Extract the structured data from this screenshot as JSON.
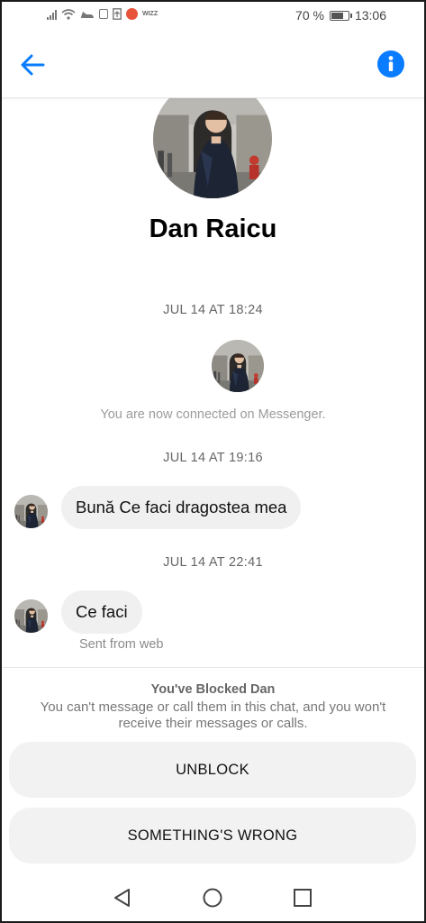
{
  "status_bar": {
    "battery_text": "70 %",
    "time": "13:06",
    "wiz_label": "WIZZ"
  },
  "header": {
    "back_icon": "back-arrow-icon",
    "info_icon": "info-icon",
    "accent_color": "#0a7cff"
  },
  "contact": {
    "name": "Dan Raicu"
  },
  "conversation": {
    "items": [
      {
        "type": "timestamp",
        "text": "JUL 14 AT 18:24"
      },
      {
        "type": "system",
        "text": "You are now connected on Messenger."
      },
      {
        "type": "timestamp",
        "text": "JUL 14 AT 19:16"
      },
      {
        "type": "message",
        "text": "Bună Ce faci dragostea mea"
      },
      {
        "type": "timestamp",
        "text": "JUL 14 AT 22:41"
      },
      {
        "type": "message",
        "text": "Ce faci",
        "footer": "Sent from web"
      }
    ]
  },
  "blocked": {
    "title": "You've Blocked Dan",
    "description": "You can't message or call them in this chat, and you won't receive their messages or calls.",
    "unblock_label": "UNBLOCK",
    "something_wrong_label": "SOMETHING'S WRONG"
  },
  "nav_bar": {
    "buttons": [
      "back-triangle-icon",
      "home-circle-icon",
      "recents-square-icon"
    ]
  }
}
